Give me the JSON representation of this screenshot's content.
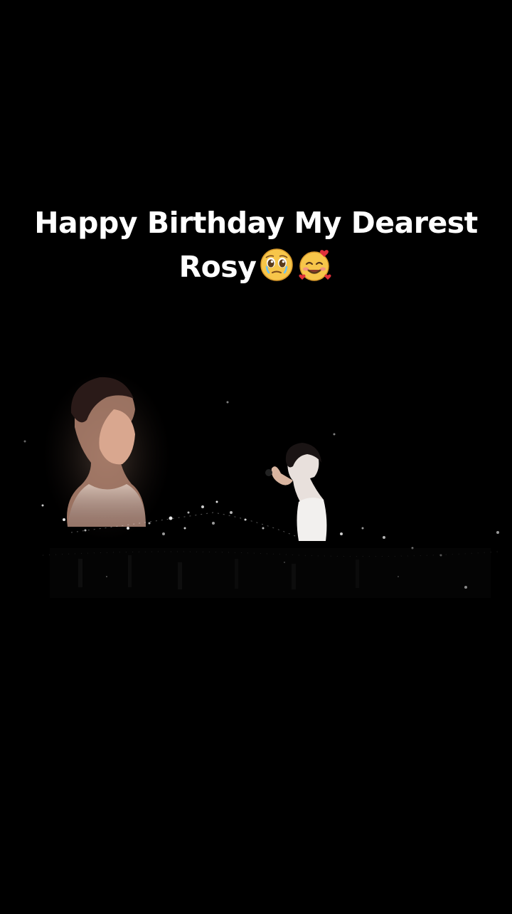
{
  "caption": {
    "line1": "Happy Birthday My Dearest",
    "line2": "Rosy"
  },
  "emojis": [
    {
      "name": "pleading-face-icon"
    },
    {
      "name": "smiling-face-with-hearts-icon"
    }
  ],
  "scene": {
    "description_icons": [
      "hologram-portrait",
      "singer-figure",
      "sparkle-particles"
    ]
  },
  "colors": {
    "background": "#000000",
    "caption_text": "#ffffff",
    "emoji_yellow": "#f7c64a",
    "heart_red": "#e0303a"
  }
}
